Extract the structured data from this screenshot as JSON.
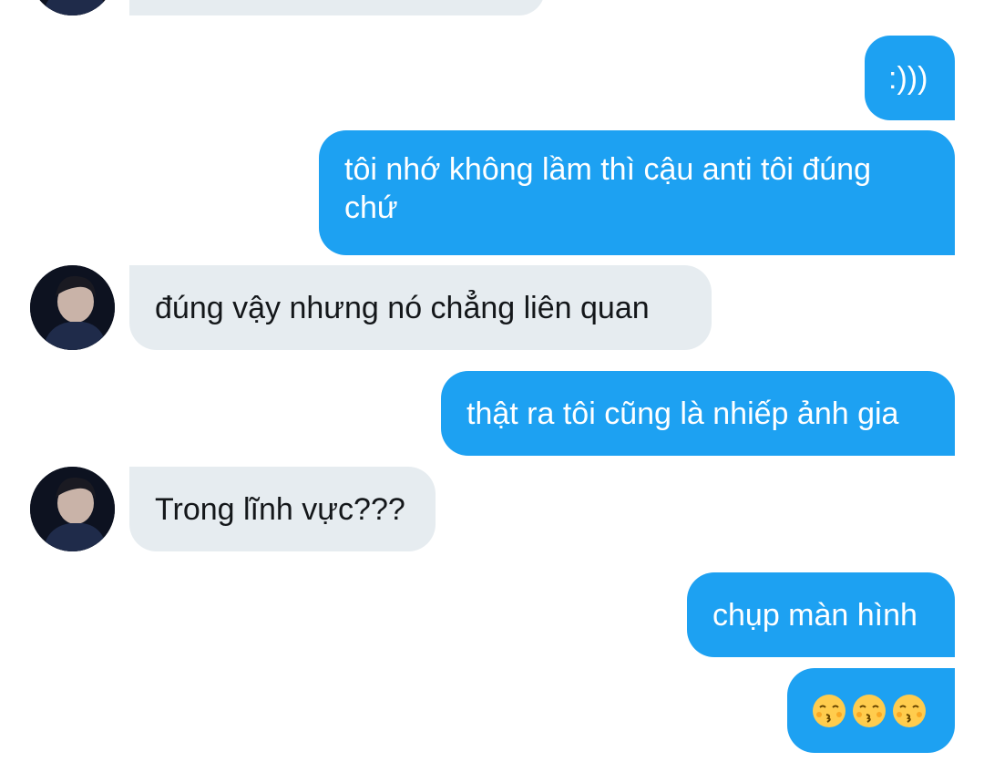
{
  "messages": [
    {
      "from": "them",
      "text": ""
    },
    {
      "from": "me",
      "text": ":)))"
    },
    {
      "from": "me",
      "text": "tôi nhớ không lầm thì cậu anti tôi đúng chứ"
    },
    {
      "from": "them",
      "text": "đúng vậy nhưng nó chẳng liên quan"
    },
    {
      "from": "me",
      "text": "thật ra tôi cũng là nhiếp ảnh gia"
    },
    {
      "from": "them",
      "text": "Trong lĩnh vực???"
    },
    {
      "from": "me",
      "text": "chụp màn hình"
    },
    {
      "from": "me",
      "emoji": [
        "kissing-face-with-closed-eyes",
        "kissing-face-with-closed-eyes",
        "kissing-face-with-closed-eyes"
      ]
    }
  ],
  "colors": {
    "outgoing_bubble": "#1da1f2",
    "incoming_bubble": "#e6ecf0",
    "outgoing_text": "#ffffff",
    "incoming_text": "#14171a"
  }
}
